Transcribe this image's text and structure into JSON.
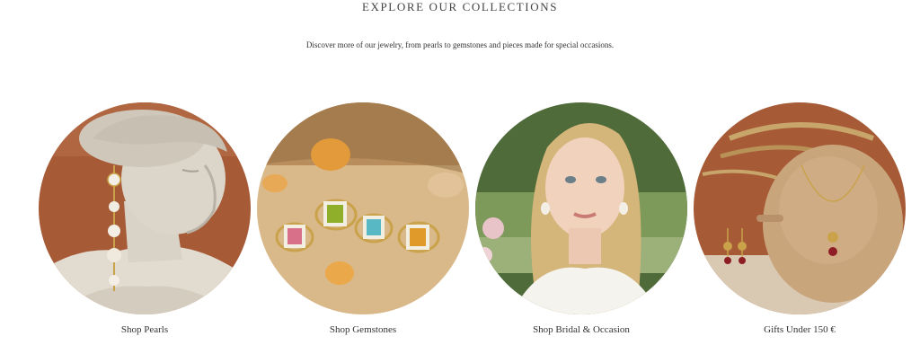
{
  "section": {
    "heading": "EXPLORE OUR COLLECTIONS",
    "subtitle": "Discover more of our jewelry, from pearls to gemstones and pieces made for special occasions."
  },
  "collections": [
    {
      "label": "Shop Pearls",
      "image": "marble-bust-pearl-earring"
    },
    {
      "label": "Shop Gemstones",
      "image": "gemstone-rings-on-sand"
    },
    {
      "label": "Shop Bridal & Occasion",
      "image": "bride-portrait-pearl-earrings"
    },
    {
      "label": "Gifts Under 150 €",
      "image": "clay-vase-garnet-jewelry"
    }
  ],
  "colors": {
    "terracotta": "#a65a36",
    "sand": "#d9b98a",
    "marble": "#d8d2c8",
    "garden_green": "#4f6b3a",
    "gold": "#c9a24a"
  }
}
